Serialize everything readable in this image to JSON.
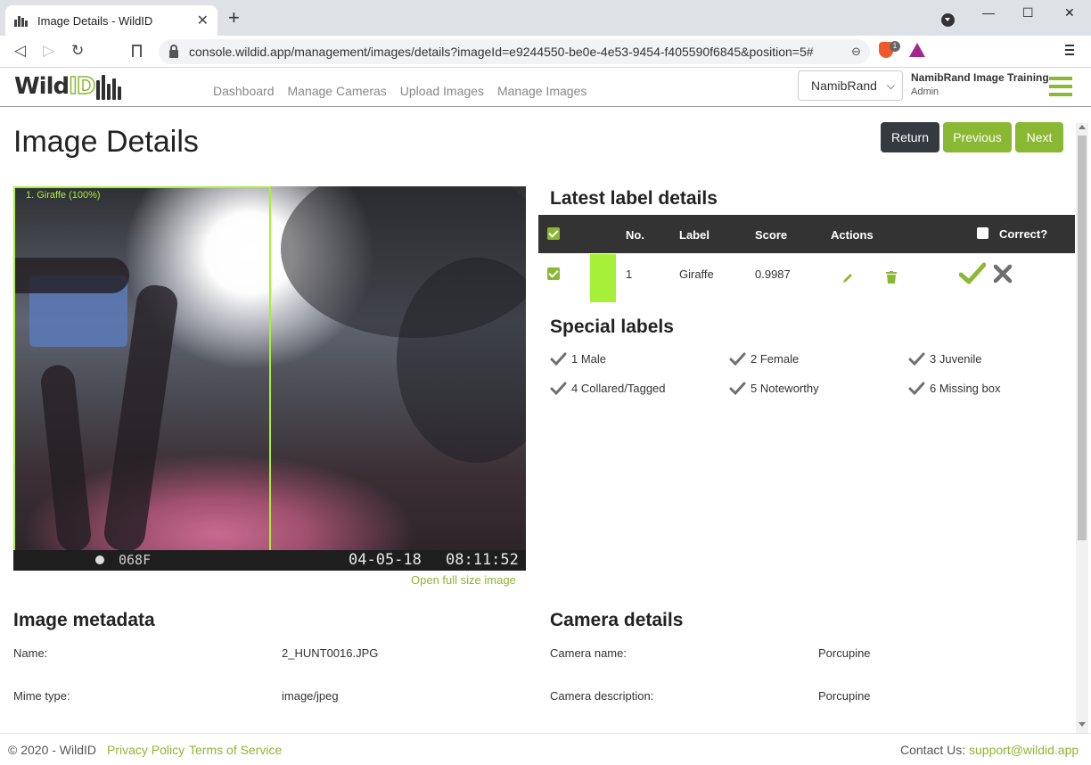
{
  "browser": {
    "tab_title": "Image Details - WildID",
    "tab_close": "✕",
    "new_tab": "+",
    "url": "console.wildid.app/management/images/details?imageId=e9244550-be0e-4e53-9454-f405590f6845&position=5#",
    "back": "◁",
    "forward": "▷",
    "reload": "↻",
    "zoom_icon": "⊖",
    "brave_badge": "1",
    "window_controls": [
      "—",
      "☐",
      "✕"
    ]
  },
  "header": {
    "logo_wild": "Wild",
    "logo_id": "ID",
    "nav": [
      "Dashboard",
      "Manage Cameras",
      "Upload Images",
      "Manage Images"
    ],
    "org_select": "NamibRand",
    "org_name": "NamibRand Image Training",
    "user_role": "Admin"
  },
  "page": {
    "title": "Image Details",
    "buttons": {
      "return": "Return",
      "previous": "Previous",
      "next": "Next"
    }
  },
  "image": {
    "box_label": "1. Giraffe (100%)",
    "temperature": "068F",
    "date": "04-05-18",
    "time": "08:11:52",
    "open_full": "Open full size image"
  },
  "labels": {
    "title": "Latest label details",
    "columns": {
      "no": "No.",
      "label": "Label",
      "score": "Score",
      "actions": "Actions",
      "correct": "Correct?"
    },
    "rows": [
      {
        "no": "1",
        "label": "Giraffe",
        "score": "0.9987",
        "color": "#a6f03a"
      }
    ]
  },
  "special": {
    "title": "Special labels",
    "items": [
      "1 Male",
      "2 Female",
      "3 Juvenile",
      "4 Collared/Tagged",
      "5 Noteworthy",
      "6 Missing box"
    ]
  },
  "metadata": {
    "title": "Image metadata",
    "name_label": "Name:",
    "name_value": "2_HUNT0016.JPG",
    "mime_label": "Mime type:",
    "mime_value": "image/jpeg"
  },
  "camera": {
    "title": "Camera details",
    "name_label": "Camera name:",
    "name_value": "Porcupine",
    "desc_label": "Camera description:",
    "desc_value": "Porcupine"
  },
  "footer": {
    "copyright": "© 2020 - WildID",
    "privacy": "Privacy Policy",
    "terms": "Terms of Service",
    "contact": "Contact Us:",
    "email": "support@wildid.app"
  },
  "colors": {
    "accent": "#8ab832",
    "dark": "#343a40",
    "bbox": "#a6f03a"
  }
}
